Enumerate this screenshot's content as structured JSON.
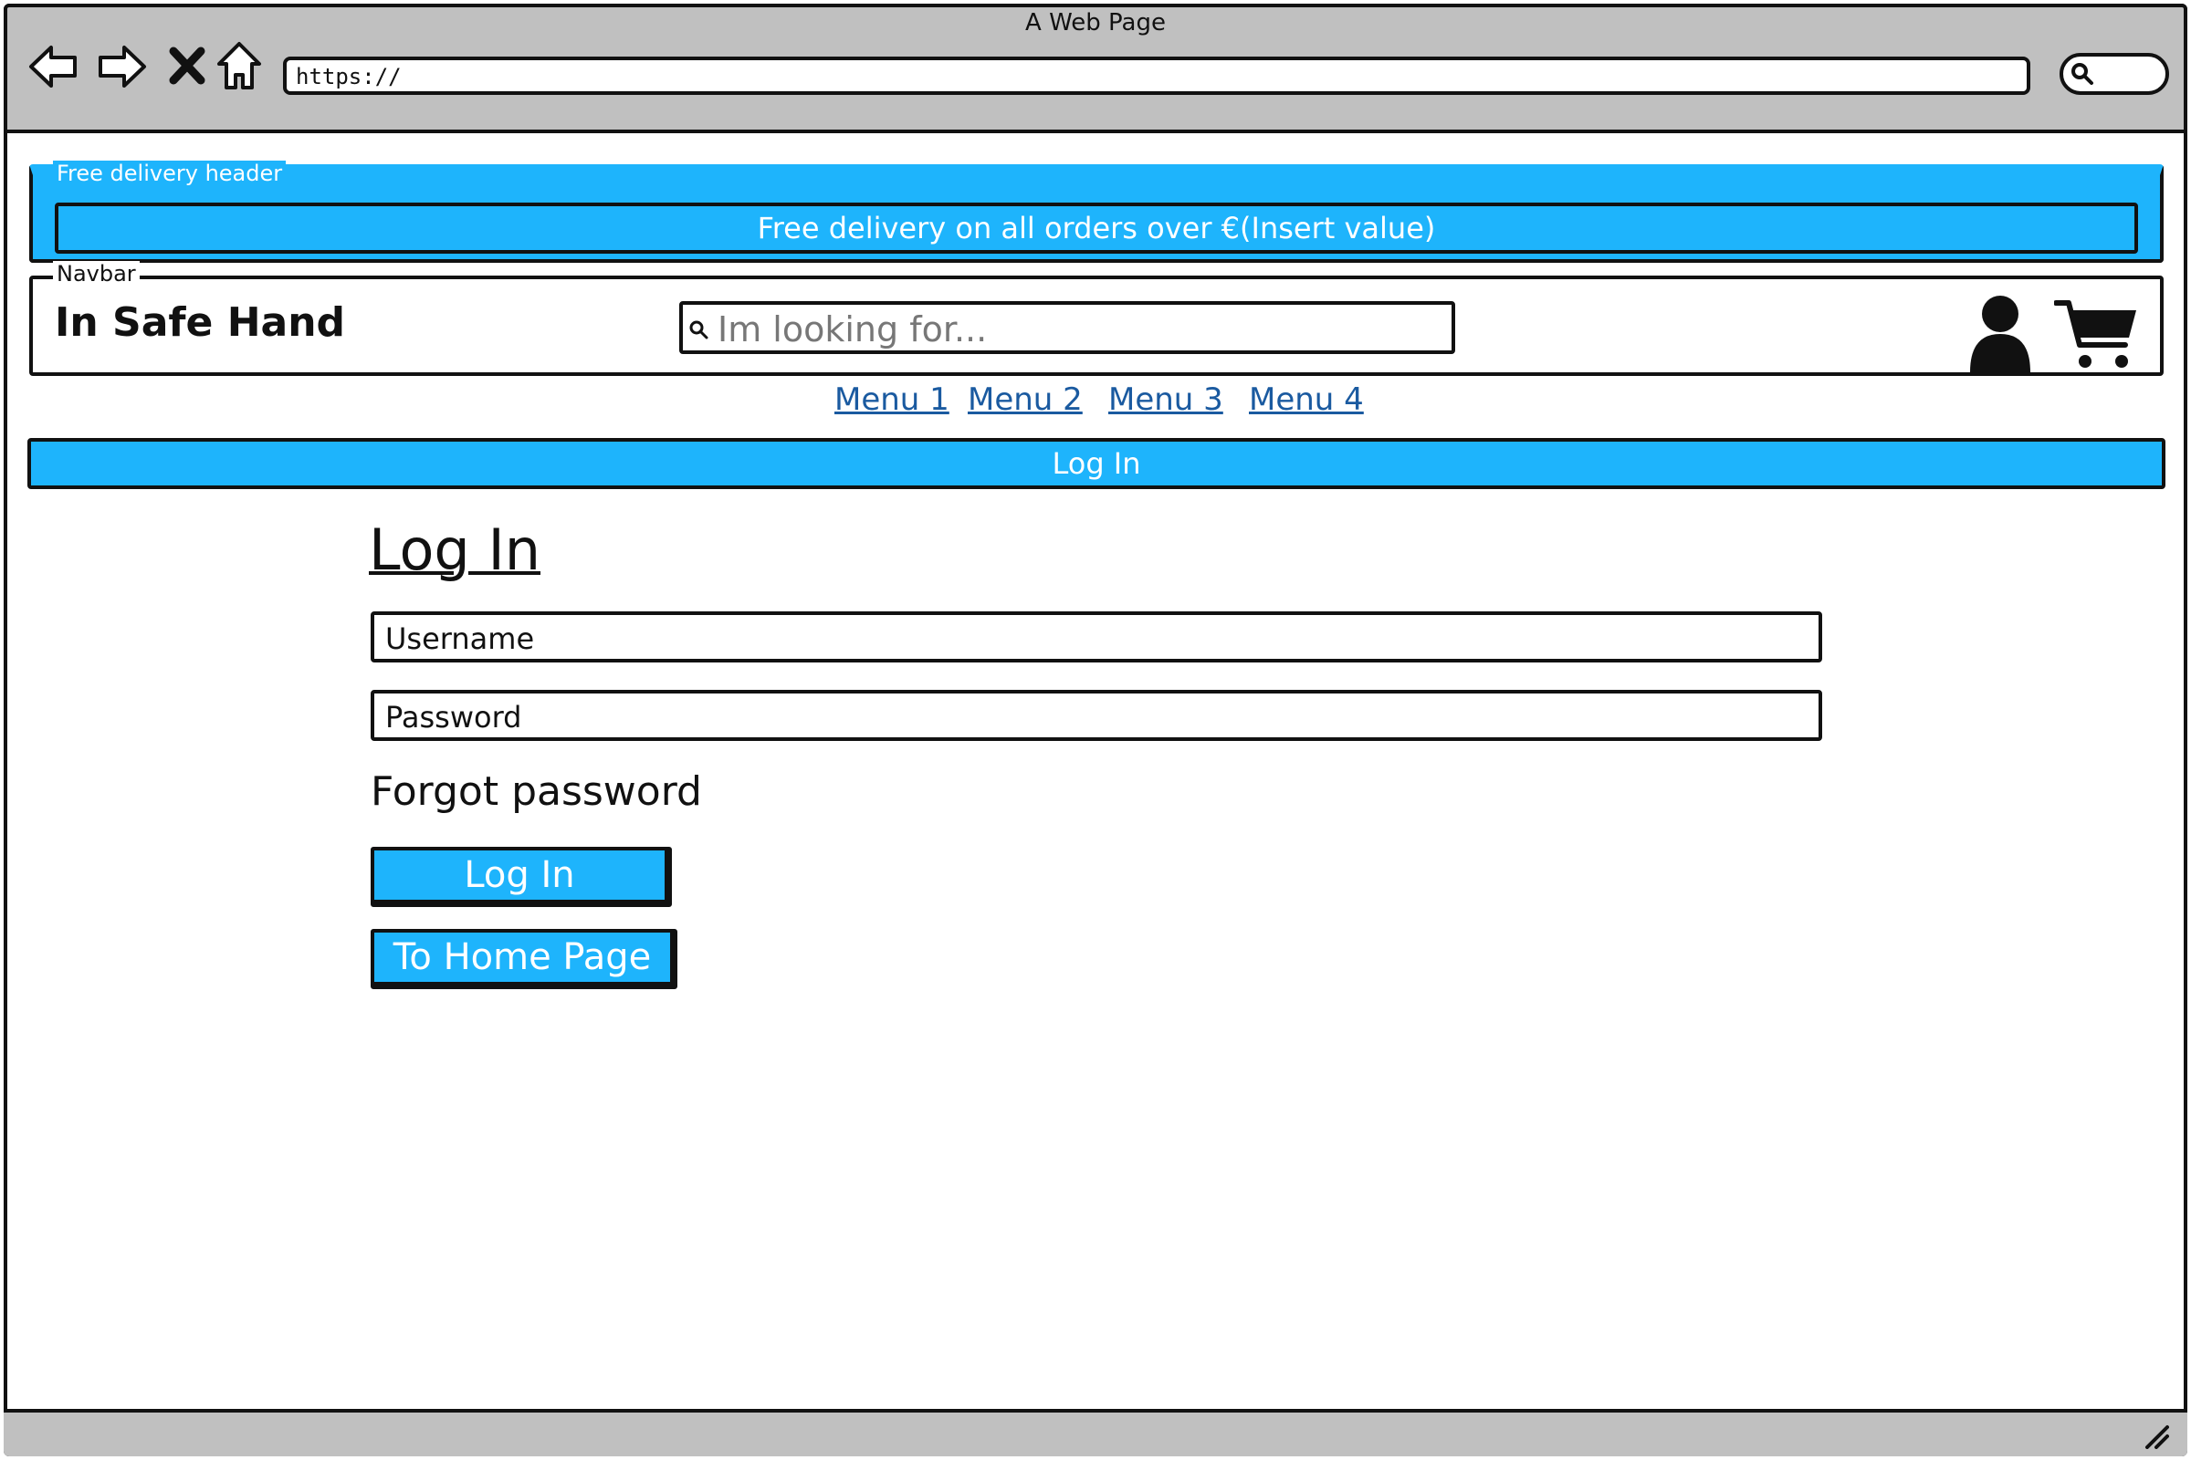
{
  "window": {
    "title": "A Web Page"
  },
  "browser": {
    "url": "https://",
    "nav_icons": [
      "back-icon",
      "forward-icon",
      "stop-icon",
      "home-icon"
    ],
    "search_icon": "search-icon"
  },
  "delivery": {
    "group_label": "Free delivery header",
    "banner_text": "Free delivery on all orders over €(Insert value)"
  },
  "navbar": {
    "group_label": "Navbar",
    "brand": "In Safe Hand",
    "search_placeholder": "Im looking for...",
    "icons": [
      "user-icon",
      "cart-icon"
    ]
  },
  "menu": {
    "items": [
      {
        "label": "Menu 1"
      },
      {
        "label": "Menu 2"
      },
      {
        "label": "Menu 3"
      },
      {
        "label": "Menu 4"
      }
    ]
  },
  "page_bar": {
    "title": "Log In"
  },
  "login": {
    "heading": "Log In",
    "username_placeholder": "Username",
    "password_placeholder": "Password",
    "forgot_label": "Forgot password",
    "login_button": "Log In",
    "home_button": "To Home Page"
  },
  "colors": {
    "accent": "#1eb4fc",
    "chrome": "#c0c0c0",
    "link": "#1a5aa0"
  }
}
